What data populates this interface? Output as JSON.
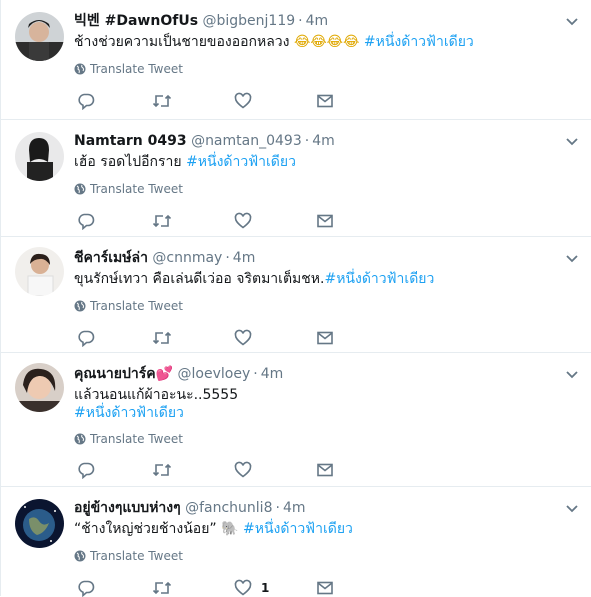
{
  "tweets": [
    {
      "name": "빅벤 #DawnOfUs",
      "handle": "@bigbenj119",
      "time": "4m",
      "text": "ช้างช่วยความเป็นชายของออกหลวง",
      "emoji": "😂😂😂😂",
      "hashtag": "#หนึ่งด้าวฟ้าเดียว",
      "translate": "Translate Tweet",
      "likes": ""
    },
    {
      "name": "Namtarn 0493",
      "handle": "@namtan_0493",
      "time": "4m",
      "text": "เฮ้อ รอดไปอีกราย",
      "hashtag": "#หนึ่งด้าวฟ้าเดียว",
      "translate": "Translate Tweet",
      "likes": ""
    },
    {
      "name": "ชีคาร์เมษ์ล่า",
      "handle": "@cnnmay",
      "time": "4m",
      "text": "ขุนรักษ์เทวา  คือเล่นดีเว่ออ จริตมาเต็มชห.",
      "hashtag": "#หนึ่งด้าวฟ้าเดียว",
      "translate": "Translate Tweet",
      "likes": ""
    },
    {
      "name": "คุณนายปาร์ค",
      "name_emoji": "💕",
      "handle": "@loevloey",
      "time": "4m",
      "text": "แล้วนอนแก้ผ้าอะนะ..5555",
      "hashtag": "#หนึ่งด้าวฟ้าเดียว",
      "translate": "Translate Tweet",
      "likes": ""
    },
    {
      "name": "อยู่ข้างๆแบบห่างๆ",
      "handle": "@fanchunli8",
      "time": "4m",
      "text": "“ช้างใหญ่ช่วยช้างน้อย”",
      "emoji": "🐘",
      "hashtag": "#หนึ่งด้าวฟ้าเดียว",
      "translate": "Translate Tweet",
      "likes": "1"
    }
  ],
  "colors": {
    "link": "#1da1f2",
    "muted": "#657786",
    "border": "#e6ecf0"
  },
  "icons": [
    "reply-icon",
    "retweet-icon",
    "like-icon",
    "message-icon",
    "globe-icon",
    "chevron-down-icon"
  ]
}
